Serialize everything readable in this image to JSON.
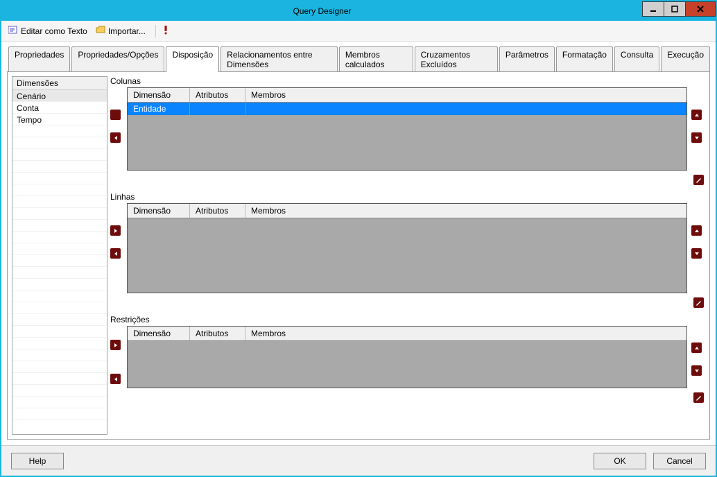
{
  "window": {
    "title": "Query Designer"
  },
  "toolbar": {
    "edit_as_text": "Editar como Texto",
    "import": "Importar..."
  },
  "tabs": [
    {
      "label": "Propriedades"
    },
    {
      "label": "Propriedades/Opções"
    },
    {
      "label": "Disposição",
      "active": true
    },
    {
      "label": "Relacionamentos entre Dimensões"
    },
    {
      "label": "Membros calculados"
    },
    {
      "label": "Cruzamentos Excluídos"
    },
    {
      "label": "Parâmetros"
    },
    {
      "label": "Formatação"
    },
    {
      "label": "Consulta"
    },
    {
      "label": "Execução"
    }
  ],
  "sidebar": {
    "header": "Dimensões",
    "items": [
      "Cenário",
      "Conta",
      "Tempo"
    ]
  },
  "grid_headers": {
    "c1": "Dimensão",
    "c2": "Atributos",
    "c3": "Membros"
  },
  "sections": {
    "colunas": {
      "title": "Colunas",
      "rows": [
        {
          "dim": "Entidade",
          "attrs": "",
          "members": ""
        }
      ]
    },
    "linhas": {
      "title": "Linhas",
      "rows": []
    },
    "restricoes": {
      "title": "Restrições",
      "rows": []
    }
  },
  "footer": {
    "help": "Help",
    "ok": "OK",
    "cancel": "Cancel"
  }
}
